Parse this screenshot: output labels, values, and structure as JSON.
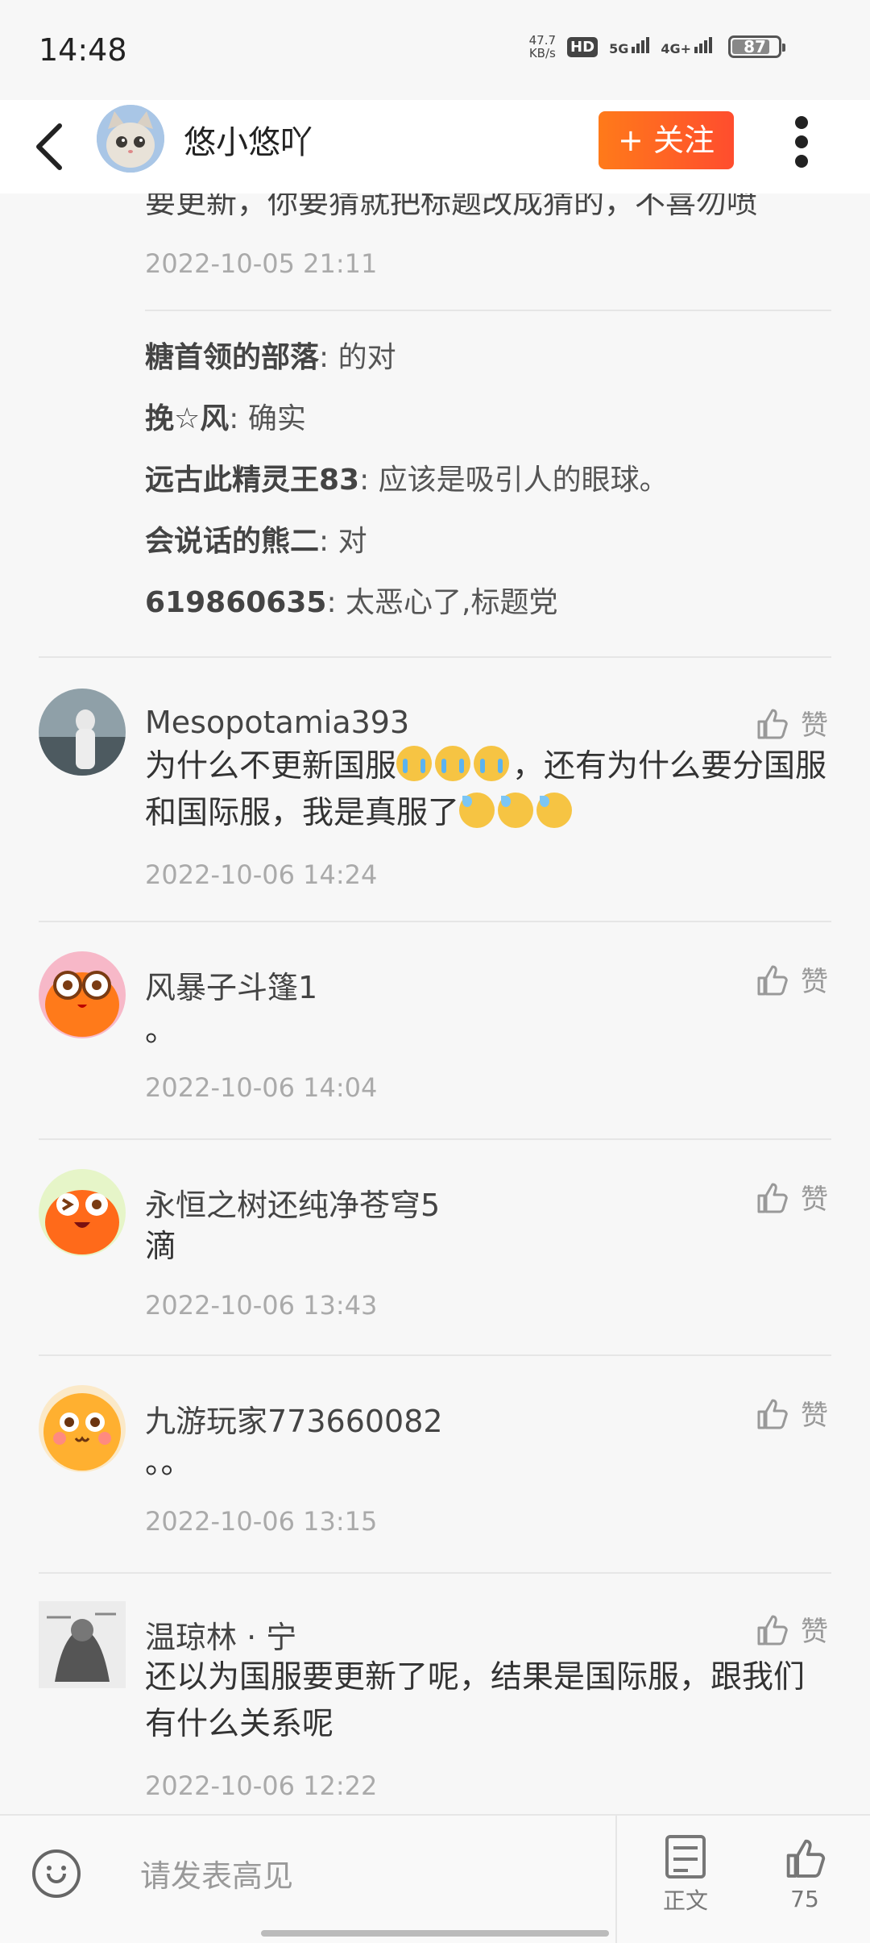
{
  "status_bar": {
    "time": "14:48",
    "net_speed_value": "47.7",
    "net_speed_unit": "KB/s",
    "hd": "HD",
    "network_5g": "5G",
    "network_4g": "4G+",
    "battery": "87"
  },
  "header": {
    "username": "悠小悠吖",
    "follow_label": "+ 关注"
  },
  "clipped_comment": {
    "text": "要更新，你要猜就把标题改成猜的，不喜勿喷",
    "date": "2022-10-05  21:11"
  },
  "replies": [
    {
      "author": "糖首领的部落",
      "text": ": 的对"
    },
    {
      "author": "挽☆风",
      "text": ": 确实"
    },
    {
      "author": "远古此精灵王83",
      "text": ": 应该是吸引人的眼球。"
    },
    {
      "author": "会说话的熊二",
      "text": ": 对"
    },
    {
      "author": "619860635",
      "text": ": 太恶心了,标题党"
    }
  ],
  "like_label": "赞",
  "comments": [
    {
      "name": "Mesopotamia393",
      "text_part1": "为什么不更新国服",
      "text_part2": "，还有为什么要分国服和国际服，我是真服了",
      "date": "2022-10-06  14:24"
    },
    {
      "name": "风暴子斗篷1",
      "text": "。",
      "date": "2022-10-06  14:04"
    },
    {
      "name": "永恒之树还纯净苍穹5",
      "text": "滴",
      "date": "2022-10-06  13:43"
    },
    {
      "name": "九游玩家773660082",
      "text": "。。",
      "date": "2022-10-06  13:15"
    },
    {
      "name": "温琼林 · 宁",
      "text": "还以为国服要更新了呢，结果是国际服，跟我们有什么关系呢",
      "date": "2022-10-06  12:22"
    }
  ],
  "bottom_bar": {
    "input_placeholder": "请发表高见",
    "article_label": "正文",
    "like_count": "75"
  }
}
